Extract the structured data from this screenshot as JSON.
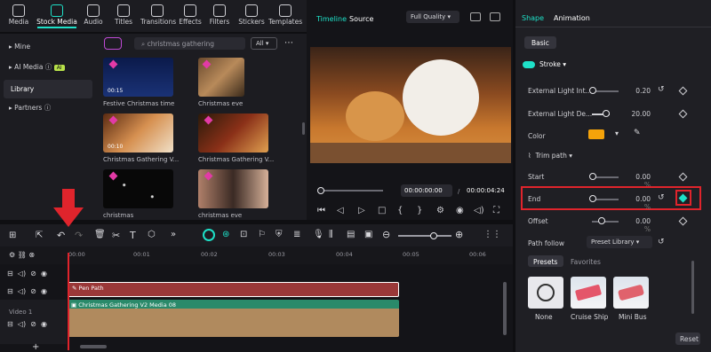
{
  "toolbar": {
    "items": [
      {
        "label": "Media",
        "icon": "media-icon"
      },
      {
        "label": "Stock Media",
        "icon": "stock-media-icon"
      },
      {
        "label": "Audio",
        "icon": "music-note-icon"
      },
      {
        "label": "Titles",
        "icon": "text-t-icon"
      },
      {
        "label": "Transitions",
        "icon": "transition-icon"
      },
      {
        "label": "Effects",
        "icon": "sparkle-icon"
      },
      {
        "label": "Filters",
        "icon": "filter-icon"
      },
      {
        "label": "Stickers",
        "icon": "sticker-icon"
      },
      {
        "label": "Templates",
        "icon": "template-icon"
      }
    ]
  },
  "sidebar": {
    "items": [
      {
        "label": "Mine"
      },
      {
        "label": "AI Media",
        "badge": "AI"
      },
      {
        "label": "Library"
      },
      {
        "label": "Partners"
      }
    ]
  },
  "media": {
    "search_value": "christmas gathering",
    "filter_label": "All",
    "thumbs": [
      {
        "caption": "Festive Christmas time",
        "duration": "00:15"
      },
      {
        "caption": "Christmas eve",
        "duration": ""
      },
      {
        "caption": "Christmas Gathering V...",
        "duration": "00:10"
      },
      {
        "caption": "Christmas Gathering V...",
        "duration": ""
      },
      {
        "caption": "christmas",
        "duration": ""
      },
      {
        "caption": "christmas eve",
        "duration": ""
      }
    ]
  },
  "preview": {
    "tab_timeline": "Timeline",
    "tab_source": "Source",
    "quality": "Full Quality",
    "current_time": "00:00:00:00",
    "total_time": "00:00:04:24"
  },
  "panel": {
    "tab_shape": "Shape",
    "tab_animation": "Animation",
    "subtab_basic": "Basic",
    "stroke_label": "Stroke",
    "ext_light_int_label": "External Light Int...",
    "ext_light_int_value": "0.20",
    "ext_light_de_label": "External Light De...",
    "ext_light_de_value": "20.00",
    "color_label": "Color",
    "accent_color": "#f5a30a",
    "trim_path_label": "Trim path",
    "start_label": "Start",
    "start_value": "0.00",
    "end_label": "End",
    "end_value": "0.00",
    "offset_label": "Offset",
    "offset_value": "0.00",
    "unit": "%",
    "path_follow_label": "Path follow",
    "path_follow_value": "Preset Library",
    "presets_tab": "Presets",
    "favorites_tab": "Favorites",
    "presets": [
      "None",
      "Cruise Ship",
      "Mini Bus"
    ],
    "reset_label": "Reset"
  },
  "timeline": {
    "ruler": [
      "00:00",
      "00:01",
      "00:02",
      "00:03",
      "00:04",
      "00:05",
      "00:06"
    ],
    "clip_pen": "Pen Path",
    "clip_video": "Christmas Gathering V2 Media 08",
    "track_video_label": "Video 1",
    "highlight_color": "#e0242c"
  }
}
